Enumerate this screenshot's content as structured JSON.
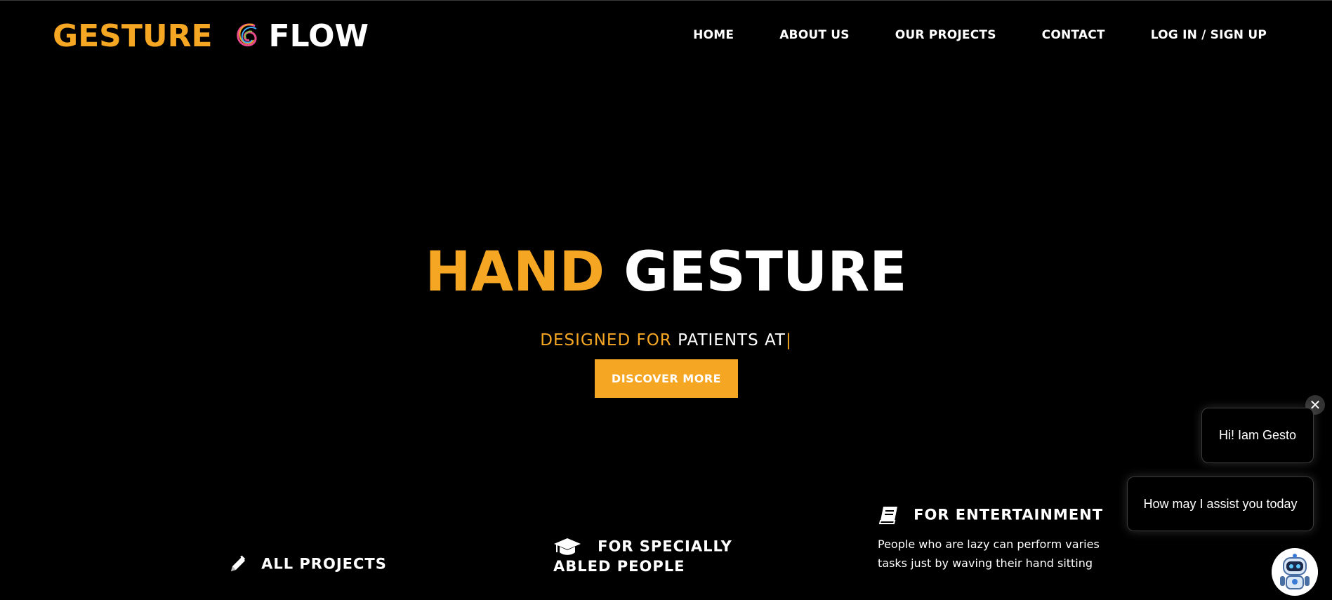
{
  "brand": {
    "word1": "GESTURE",
    "word2": "FLOW",
    "logo_icon": "swirl-logo-icon",
    "accent": "#f5a623"
  },
  "nav": {
    "items": [
      {
        "label": "HOME"
      },
      {
        "label": "ABOUT US"
      },
      {
        "label": "OUR PROJECTS"
      },
      {
        "label": "CONTACT"
      },
      {
        "label": "LOG IN / SIGN UP"
      }
    ]
  },
  "hero": {
    "title_part1": "HAND",
    "title_part2": "GESTURE",
    "subtitle_part1": "DESIGNED FOR",
    "subtitle_part2": "PATIENTS AT",
    "caret": "|",
    "cta_label": "DISCOVER MORE"
  },
  "features": [
    {
      "icon": "pencil-icon",
      "title": "ALL PROJECTS"
    },
    {
      "icon": "graduation-cap-icon",
      "title_line1": "FOR SPECIALLY",
      "title_line2": "ABLED PEOPLE"
    },
    {
      "icon": "book-icon",
      "title": "FOR ENTERTAINMENT",
      "description": "People who are lazy can perform varies tasks just by waving their hand sitting"
    }
  ],
  "chat": {
    "close_label": "✕",
    "messages": [
      "Hi! Iam Gesto",
      "How may I assist you today"
    ],
    "avatar_icon": "robot-avatar-icon"
  }
}
